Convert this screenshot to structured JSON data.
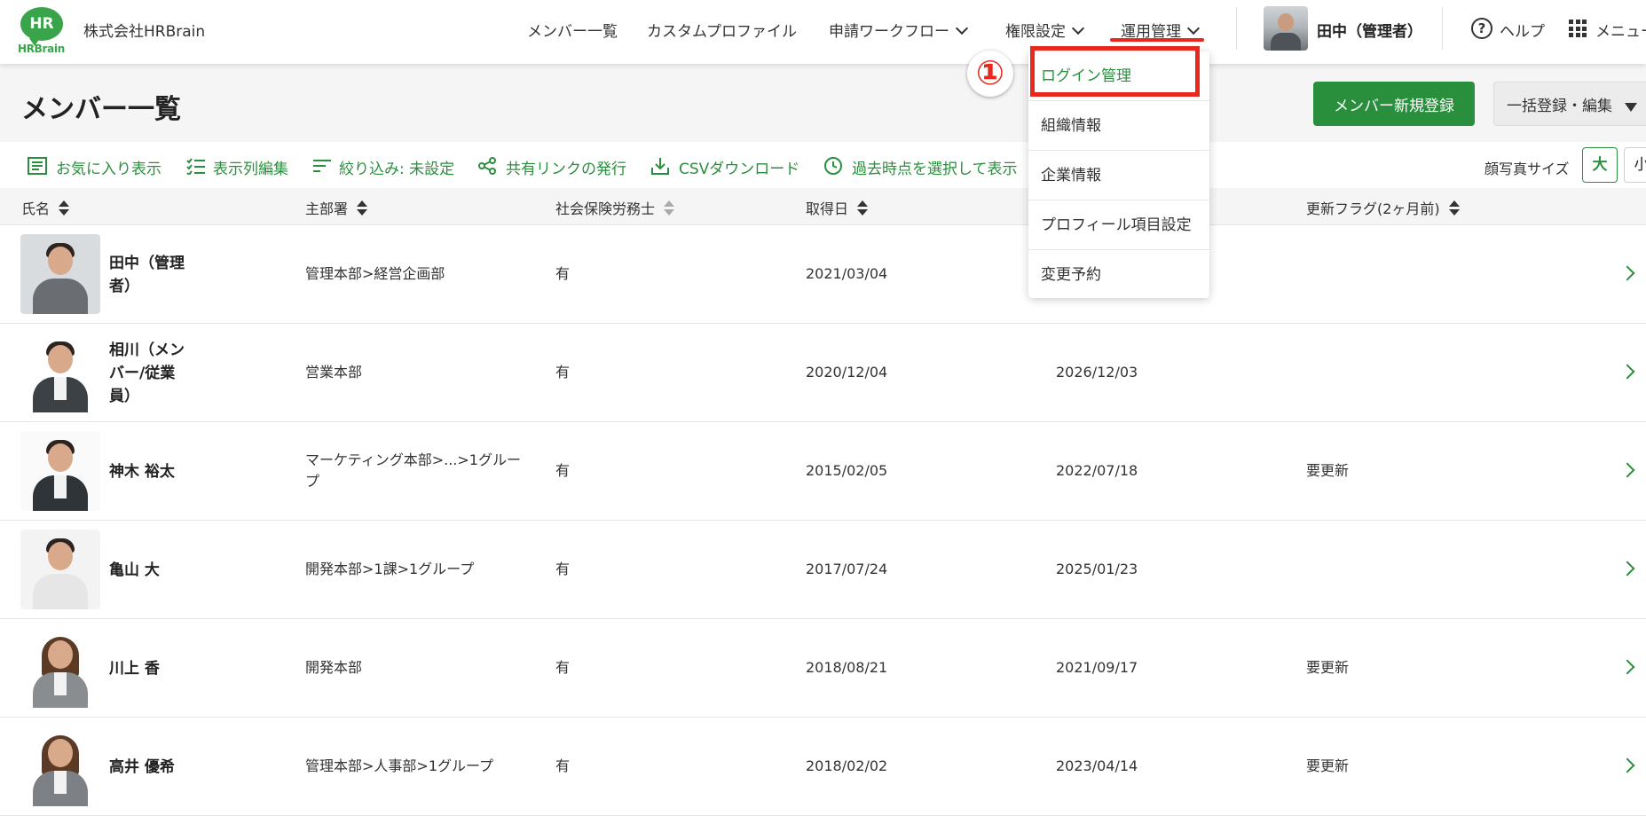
{
  "header": {
    "logo_text": "HR",
    "logo_brand": "HRBrain",
    "company": "株式会社HRBrain",
    "nav": [
      {
        "label": "メンバー一覧",
        "has_menu": false
      },
      {
        "label": "カスタムプロファイル",
        "has_menu": false
      },
      {
        "label": "申請ワークフロー",
        "has_menu": true
      },
      {
        "label": "権限設定",
        "has_menu": true
      },
      {
        "label": "運用管理",
        "has_menu": true,
        "active": true
      }
    ],
    "user_name": "田中（管理者）",
    "help_label": "ヘルプ",
    "menu_label": "メニュー"
  },
  "page": {
    "title": "メンバー一覧",
    "new_button": "メンバー新規登録",
    "bulk_button": "一括登録・編集"
  },
  "toolbar": {
    "favorites": "お気に入り表示",
    "columns": "表示列編集",
    "filter": "絞り込み: 未設定",
    "share": "共有リンクの発行",
    "csv": "CSVダウンロード",
    "history": "過去時点を選択して表示",
    "photo_size_label": "顔写真サイズ",
    "size_large": "大",
    "size_small": "小"
  },
  "table": {
    "headers": [
      "氏名",
      "主部署",
      "社会保険労務士",
      "取得日",
      "更新フラグ(2ヶ月前)"
    ],
    "rows": [
      {
        "name": "田中（管理\n者）",
        "dept": "管理本部>経営企画部",
        "sr": "有",
        "date": "2021/03/04",
        "expiry": "",
        "flag": ""
      },
      {
        "name": "相川（メン\nバー/従業\n員）",
        "dept": "営業本部",
        "sr": "有",
        "date": "2020/12/04",
        "expiry": "2026/12/03",
        "flag": ""
      },
      {
        "name": "神木 裕太",
        "dept": "マーケティング本部>...>1グルー\nプ",
        "sr": "有",
        "date": "2015/02/05",
        "expiry": "2022/07/18",
        "flag": "要更新"
      },
      {
        "name": "亀山 大",
        "dept": "開発本部>1課>1グループ",
        "sr": "有",
        "date": "2017/07/24",
        "expiry": "2025/01/23",
        "flag": ""
      },
      {
        "name": "川上 香",
        "dept": "開発本部",
        "sr": "有",
        "date": "2018/08/21",
        "expiry": "2021/09/17",
        "flag": "要更新"
      },
      {
        "name": "高井 優希",
        "dept": "管理本部>人事部>1グループ",
        "sr": "有",
        "date": "2018/02/02",
        "expiry": "2023/04/14",
        "flag": "要更新"
      }
    ]
  },
  "dropdown": {
    "items": [
      "ログイン管理",
      "組織情報",
      "企業情報",
      "プロフィール項目設定",
      "変更予約"
    ]
  },
  "annotation": {
    "step": "①"
  },
  "colors": {
    "brand_green": "#2a8f3d",
    "logo_green": "#3aa44b",
    "highlight_red": "#e8281e"
  }
}
